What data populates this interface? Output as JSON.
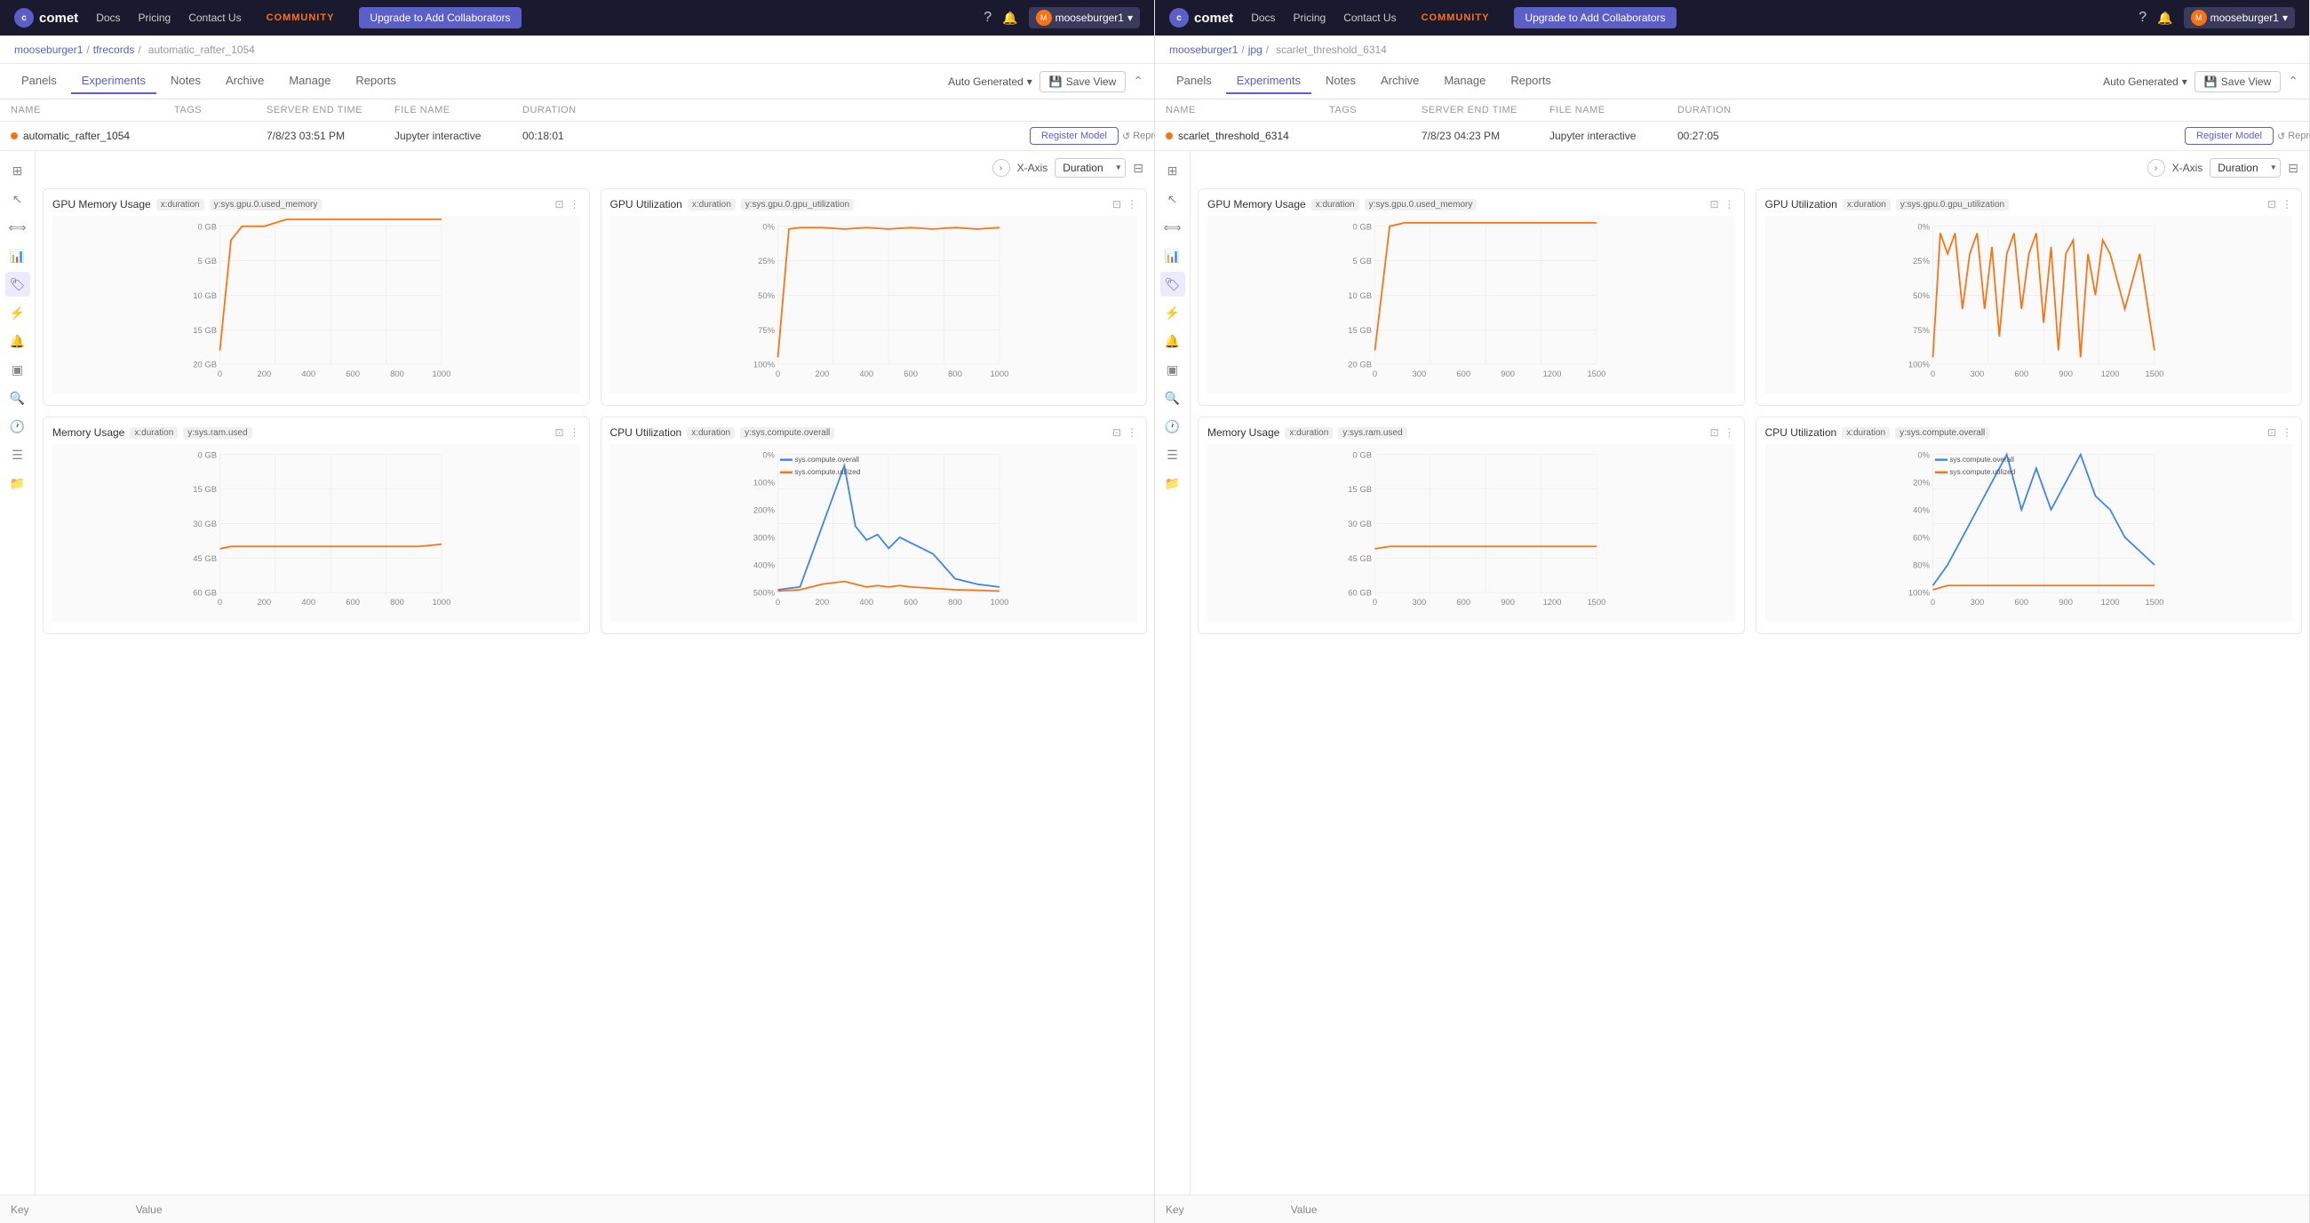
{
  "panels": [
    {
      "id": "left",
      "nav": {
        "logo": "comet",
        "links": [
          "Docs",
          "Pricing",
          "Contact Us"
        ],
        "community": "COMMUNITY",
        "upgrade_btn": "Upgrade to Add Collaborators",
        "user": "mooseburger1"
      },
      "breadcrumb": {
        "user": "mooseburger1",
        "project": "tfrecords",
        "experiment": "automatic_rafter_1054"
      },
      "tabs": [
        "Panels",
        "Experiments",
        "Notes",
        "Archive",
        "Manage",
        "Reports"
      ],
      "active_tab": "Experiments",
      "auto_generated": "Auto Generated",
      "save_view": "Save View",
      "experiment": {
        "name": "automatic_rafter_1054",
        "tags": "",
        "server_end_time": "7/8/23 03:51 PM",
        "file_name": "Jupyter interactive",
        "duration": "00:18:01",
        "register_model": "Register Model",
        "reproduce": "Reproduce"
      },
      "xaxis": {
        "label": "X-Axis",
        "value": "Duration"
      },
      "charts": [
        {
          "id": "gpu-memory",
          "title": "GPU Memory Usage",
          "tags": [
            "x:duration",
            "y:sys.gpu.0.used_memory"
          ],
          "type": "line_orange",
          "ymax": "20 GB",
          "data": [
            [
              0,
              2
            ],
            [
              50,
              18
            ],
            [
              100,
              20
            ],
            [
              200,
              20
            ],
            [
              300,
              21
            ],
            [
              400,
              21
            ],
            [
              500,
              21
            ],
            [
              600,
              21
            ],
            [
              700,
              21
            ],
            [
              800,
              21
            ],
            [
              900,
              21
            ],
            [
              1000,
              21
            ]
          ],
          "xmax": 1000
        },
        {
          "id": "gpu-util",
          "title": "GPU Utilization",
          "tags": [
            "x:duration",
            "y:sys.gpu.0.gpu_utilization"
          ],
          "type": "line_orange",
          "ymax": "100%",
          "data": [
            [
              0,
              5
            ],
            [
              50,
              98
            ],
            [
              100,
              99
            ],
            [
              200,
              99
            ],
            [
              300,
              98
            ],
            [
              400,
              99
            ],
            [
              500,
              98
            ],
            [
              600,
              99
            ],
            [
              700,
              98
            ],
            [
              800,
              99
            ],
            [
              900,
              98
            ],
            [
              1000,
              99
            ]
          ],
          "xmax": 1000
        },
        {
          "id": "memory-usage",
          "title": "Memory Usage",
          "tags": [
            "x:duration",
            "y:sys.ram.used"
          ],
          "type": "line_orange",
          "data": [
            [
              0,
              19
            ],
            [
              50,
              20
            ],
            [
              100,
              20
            ],
            [
              200,
              20
            ],
            [
              300,
              20
            ],
            [
              400,
              20
            ],
            [
              500,
              20
            ],
            [
              600,
              20
            ],
            [
              700,
              20
            ],
            [
              800,
              20
            ],
            [
              900,
              20
            ],
            [
              1000,
              21
            ]
          ],
          "ymax": "60 GB",
          "xmax": 1000
        },
        {
          "id": "cpu-util",
          "title": "CPU Utilization",
          "tags": [
            "x:duration",
            "y:sys.compute.overall"
          ],
          "type": "line_blue_multi",
          "legend": [
            "sys.compute.overall",
            "sys.compute.utilized"
          ],
          "data_overall": [
            [
              0,
              10
            ],
            [
              100,
              20
            ],
            [
              200,
              240
            ],
            [
              300,
              460
            ],
            [
              350,
              240
            ],
            [
              400,
              190
            ],
            [
              450,
              210
            ],
            [
              500,
              160
            ],
            [
              550,
              200
            ],
            [
              600,
              180
            ],
            [
              700,
              140
            ],
            [
              800,
              50
            ],
            [
              900,
              30
            ],
            [
              1000,
              20
            ]
          ],
          "data_utilized": [
            [
              0,
              5
            ],
            [
              100,
              10
            ],
            [
              200,
              30
            ],
            [
              300,
              40
            ],
            [
              350,
              30
            ],
            [
              400,
              20
            ],
            [
              450,
              25
            ],
            [
              500,
              20
            ],
            [
              550,
              25
            ],
            [
              600,
              20
            ],
            [
              700,
              15
            ],
            [
              800,
              10
            ],
            [
              900,
              8
            ],
            [
              1000,
              5
            ]
          ],
          "ymax": "500%",
          "xmax": 1000
        }
      ],
      "footer": {
        "key": "Key",
        "value": "Value"
      }
    },
    {
      "id": "right",
      "nav": {
        "logo": "comet",
        "links": [
          "Docs",
          "Pricing",
          "Contact Us"
        ],
        "community": "COMMUNITY",
        "upgrade_btn": "Upgrade to Add Collaborators",
        "user": "mooseburger1"
      },
      "breadcrumb": {
        "user": "mooseburger1",
        "project": "jpg",
        "experiment": "scarlet_threshold_6314"
      },
      "tabs": [
        "Panels",
        "Experiments",
        "Notes",
        "Archive",
        "Manage",
        "Reports"
      ],
      "active_tab": "Experiments",
      "auto_generated": "Auto Generated",
      "save_view": "Save View",
      "experiment": {
        "name": "scarlet_threshold_6314",
        "tags": "",
        "server_end_time": "7/8/23 04:23 PM",
        "file_name": "Jupyter interactive",
        "duration": "00:27:05",
        "register_model": "Register Model",
        "reproduce": "Reproduce"
      },
      "xaxis": {
        "label": "X-Axis",
        "value": "Duration"
      },
      "charts": [
        {
          "id": "gpu-memory-r",
          "title": "GPU Memory Usage",
          "tags": [
            "x:duration",
            "y:sys.gpu.0.used_memory"
          ],
          "type": "line_orange_flat",
          "data": [
            [
              0,
              2
            ],
            [
              100,
              20
            ],
            [
              200,
              20.5
            ],
            [
              400,
              20.5
            ],
            [
              600,
              20.5
            ],
            [
              800,
              20.5
            ],
            [
              1000,
              20.5
            ],
            [
              1200,
              20.5
            ],
            [
              1400,
              20.5
            ],
            [
              1500,
              20.5
            ]
          ],
          "ymax": "20 GB",
          "xmax": 1500
        },
        {
          "id": "gpu-util-r",
          "title": "GPU Utilization",
          "tags": [
            "x:duration",
            "y:sys.gpu.0.gpu_utilization"
          ],
          "type": "line_orange_spiky",
          "data": [
            [
              0,
              5
            ],
            [
              50,
              95
            ],
            [
              100,
              80
            ],
            [
              150,
              95
            ],
            [
              200,
              40
            ],
            [
              250,
              80
            ],
            [
              300,
              95
            ],
            [
              350,
              40
            ],
            [
              400,
              85
            ],
            [
              450,
              20
            ],
            [
              500,
              80
            ],
            [
              550,
              95
            ],
            [
              600,
              40
            ],
            [
              650,
              80
            ],
            [
              700,
              95
            ],
            [
              750,
              30
            ],
            [
              800,
              85
            ],
            [
              850,
              10
            ],
            [
              900,
              80
            ],
            [
              950,
              90
            ],
            [
              1000,
              5
            ],
            [
              1050,
              80
            ],
            [
              1100,
              50
            ],
            [
              1150,
              90
            ],
            [
              1200,
              80
            ],
            [
              1300,
              40
            ],
            [
              1400,
              80
            ],
            [
              1500,
              10
            ]
          ],
          "ymax": "100%",
          "xmax": 1500
        },
        {
          "id": "memory-usage-r",
          "title": "Memory Usage",
          "tags": [
            "x:duration",
            "y:sys.ram.used"
          ],
          "type": "line_orange",
          "data": [
            [
              0,
              19
            ],
            [
              100,
              20
            ],
            [
              200,
              20
            ],
            [
              400,
              20
            ],
            [
              600,
              20
            ],
            [
              800,
              20
            ],
            [
              1000,
              20
            ],
            [
              1200,
              20
            ],
            [
              1400,
              20
            ],
            [
              1500,
              20
            ]
          ],
          "ymax": "60 GB",
          "xmax": 1500
        },
        {
          "id": "cpu-util-r",
          "title": "CPU Utilization",
          "tags": [
            "x:duration",
            "y:sys.compute.overall"
          ],
          "type": "line_blue_multi_r",
          "legend": [
            "sys.compute.overall",
            "sys.compute.utilized"
          ],
          "data_overall": [
            [
              0,
              5
            ],
            [
              100,
              20
            ],
            [
              200,
              40
            ],
            [
              300,
              60
            ],
            [
              400,
              80
            ],
            [
              500,
              100
            ],
            [
              600,
              60
            ],
            [
              700,
              90
            ],
            [
              800,
              60
            ],
            [
              900,
              80
            ],
            [
              1000,
              100
            ],
            [
              1100,
              70
            ],
            [
              1200,
              60
            ],
            [
              1300,
              40
            ],
            [
              1400,
              30
            ],
            [
              1500,
              20
            ]
          ],
          "data_utilized": [
            [
              0,
              2
            ],
            [
              100,
              5
            ],
            [
              200,
              5
            ],
            [
              300,
              5
            ],
            [
              400,
              5
            ],
            [
              500,
              5
            ],
            [
              600,
              5
            ],
            [
              700,
              5
            ],
            [
              800,
              5
            ],
            [
              900,
              5
            ],
            [
              1000,
              5
            ],
            [
              1100,
              5
            ],
            [
              1200,
              5
            ],
            [
              1300,
              5
            ],
            [
              1400,
              5
            ],
            [
              1500,
              5
            ]
          ],
          "ymax": "100%",
          "xmax": 1500
        }
      ],
      "footer": {
        "key": "Key",
        "value": "Value"
      }
    }
  ],
  "sidebar_icons": [
    "grid",
    "cursor",
    "expand",
    "chart-bar",
    "tag",
    "lightning",
    "bell",
    "layers",
    "search",
    "clock",
    "list",
    "folder"
  ],
  "header_cols": {
    "name": "NAME",
    "tags": "TAGS",
    "server_end_time": "SERVER END TIME",
    "file_name": "FILE NAME",
    "duration": "DURATION"
  }
}
